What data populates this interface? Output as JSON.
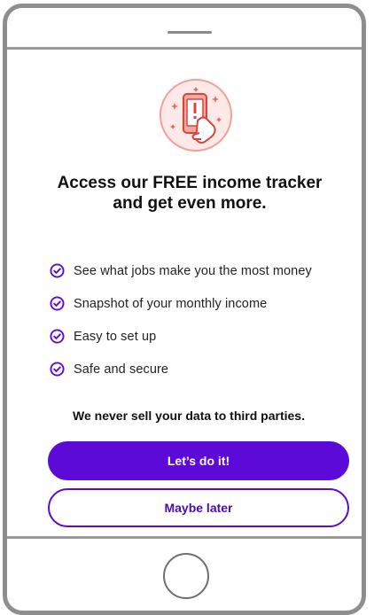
{
  "headline": {
    "line1": "Access our FREE income tracker",
    "line2": "and get even more."
  },
  "features": [
    "See what jobs make you the most money",
    "Snapshot of your monthly income",
    "Easy to set up",
    "Safe and secure"
  ],
  "privacy_note": "We never sell your data to third parties.",
  "buttons": {
    "primary": "Let’s do it!",
    "secondary": "Maybe later"
  },
  "icons": {
    "hero": "phone-alert-hand-icon",
    "check": "check-circle-icon"
  },
  "colors": {
    "accent": "#5b0ad8",
    "hero_pink": "#f6b8b3",
    "hero_bg": "#fde9e7"
  }
}
